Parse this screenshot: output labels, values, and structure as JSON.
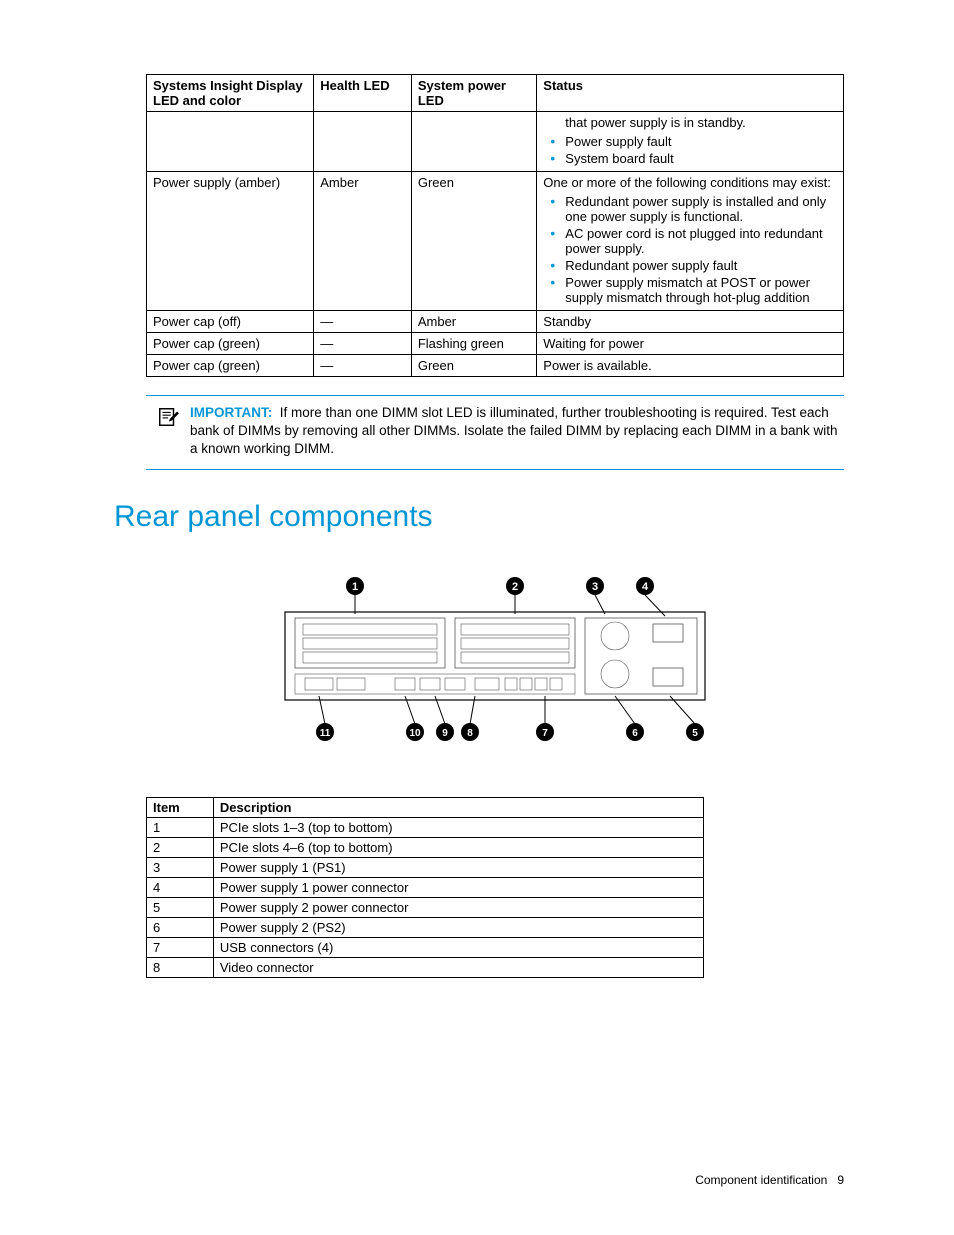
{
  "table1": {
    "headers": [
      "Systems Insight Display LED and color",
      "Health LED",
      "System power LED",
      "Status"
    ],
    "rows": [
      {
        "c0": "",
        "c1": "",
        "c2": "",
        "status_text": "that power supply is in standby.",
        "bullets": [
          "Power supply fault",
          "System board fault"
        ]
      },
      {
        "c0": "Power supply (amber)",
        "c1": "Amber",
        "c2": "Green",
        "status_text": "One or more of the following conditions may exist:",
        "bullets": [
          "Redundant power supply is installed and only one power supply is functional.",
          "AC power cord is not plugged into redundant power supply.",
          "Redundant power supply fault",
          "Power supply mismatch at POST or power supply mismatch through hot-plug addition"
        ]
      },
      {
        "c0": "Power cap (off)",
        "c1": "—",
        "c2": "Amber",
        "status_text": "Standby",
        "bullets": []
      },
      {
        "c0": "Power cap (green)",
        "c1": "—",
        "c2": "Flashing green",
        "status_text": "Waiting for power",
        "bullets": []
      },
      {
        "c0": "Power cap (green)",
        "c1": "—",
        "c2": "Green",
        "status_text": "Power is available.",
        "bullets": []
      }
    ]
  },
  "important": {
    "label": "IMPORTANT:",
    "text": "If more than one DIMM slot LED is illuminated, further troubleshooting is required. Test each bank of DIMMs by removing all other DIMMs. Isolate the failed DIMM by replacing each DIMM in a bank with a known working DIMM."
  },
  "section_heading": "Rear panel components",
  "callouts_top": [
    "1",
    "2",
    "3",
    "4"
  ],
  "callouts_bottom": [
    "11",
    "10",
    "9",
    "8",
    "7",
    "6",
    "5"
  ],
  "table2": {
    "headers": [
      "Item",
      "Description"
    ],
    "rows": [
      {
        "item": "1",
        "desc": "PCIe slots 1–3 (top to bottom)"
      },
      {
        "item": "2",
        "desc": "PCIe slots 4–6 (top to bottom)"
      },
      {
        "item": "3",
        "desc": "Power supply 1 (PS1)"
      },
      {
        "item": "4",
        "desc": "Power supply 1 power connector"
      },
      {
        "item": "5",
        "desc": "Power supply 2 power connector"
      },
      {
        "item": "6",
        "desc": "Power supply 2 (PS2)"
      },
      {
        "item": "7",
        "desc": "USB connectors (4)"
      },
      {
        "item": "8",
        "desc": "Video connector"
      }
    ]
  },
  "footer": {
    "section": "Component identification",
    "page": "9"
  }
}
